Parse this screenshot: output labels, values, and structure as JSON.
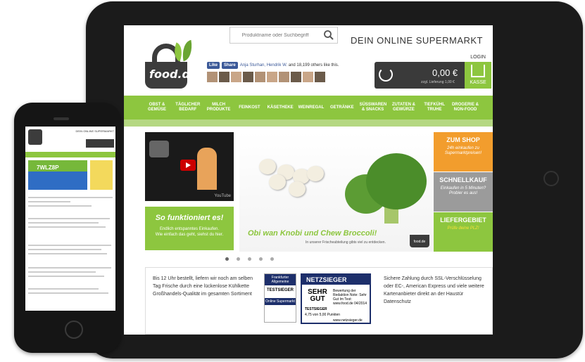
{
  "header": {
    "search_placeholder": "Produktname oder Suchbegriff",
    "tagline": "DEIN ONLINE SUPERMARKT",
    "logo_text": "food.de",
    "login": "LOGIN"
  },
  "facebook": {
    "like": "Like",
    "share": "Share",
    "names": "Anja Sturhan, Hendrik W.",
    "others": " and 18,199 others like this."
  },
  "cart": {
    "price": "0,00 €",
    "sub": "zzgl. Lieferung 1,00 €",
    "checkout": "KASSE"
  },
  "nav": [
    "OBST & GEMÜSE",
    "TÄGLICHER BEDARF",
    "MILCH PRODUKTE",
    "FEINKOST",
    "KÄSETHEKE",
    "WEINREGAL",
    "GETRÄNKE",
    "SÜSSWAREN & SNACKS",
    "ZUTATEN & GEWÜRZE",
    "TIEFKÜHL TRUHE",
    "DROGERIE & NON-FOOD"
  ],
  "video": {
    "yt": "YouTube"
  },
  "how": {
    "title": "So funktioniert es!",
    "line1": "Endlich entspanntes Einkaufen.",
    "line2": "Wie einfach das geht, siehst du hier."
  },
  "banner": {
    "title": "Obi wan Knobi und Chew Broccoli!",
    "sub": "In unserer Frischeabteilung gibts viel zu entdecken.",
    "logo": "food.de"
  },
  "side": [
    {
      "title": "ZUM SHOP",
      "text": "24h einkaufen zu Supermarktpreisen!"
    },
    {
      "title": "SCHNELLKAUF",
      "text": "Einkaufen in 5 Minuten? Probier es aus!"
    },
    {
      "title": "LIEFERGEBIET",
      "text": "Prüfe deine PLZ!"
    }
  ],
  "info": {
    "left": "Bis 12 Uhr bestellt, liefern wir noch am selben Tag Frische durch eine lückenlose Kühlkette Großhandels-Qualität im gesamten Sortiment",
    "right": "Sichere Zahlung durch SSL-Verschlüsselung oder EC-, American Express und viele weitere Kartenanbieter direkt an der Haustür Datenschutz"
  },
  "seal": {
    "header": "Frankfurter Allgemeine",
    "label": "Online Supermarkt",
    "badge": "TESTSIEGER"
  },
  "netzsieger": {
    "title": "NETZSIEGER",
    "grade": "SEHR GUT",
    "details": "Bewertung der Redaktion Note: Sehr Gut Im Test: www.food.de 04/2014",
    "testsieger": "TESTSIEGER",
    "score": "4,75 von 5,00 Punkten",
    "site": "www.netzsieger.de"
  },
  "phone": {
    "tagline": "DEIN ONLINE SUPERMARKT",
    "code": "7WLZ8P"
  }
}
